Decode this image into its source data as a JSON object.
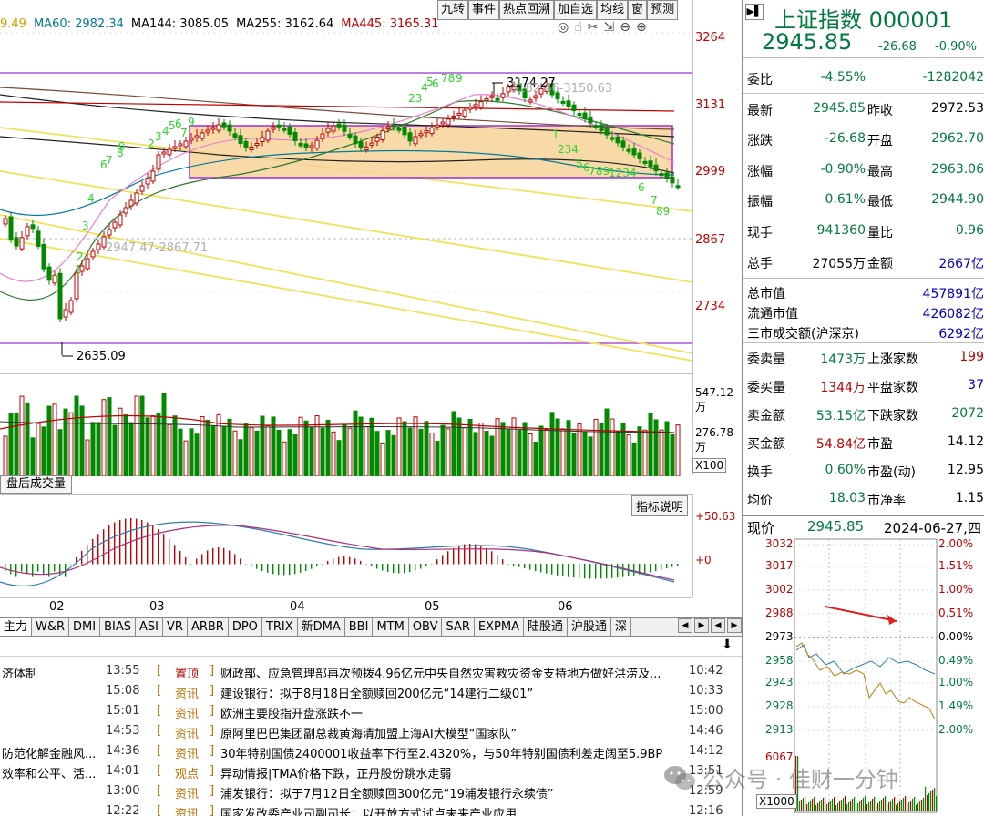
{
  "top_tabs": [
    "九转",
    "事件",
    "热点回溯",
    "加自选",
    "均线",
    "窗",
    "预测"
  ],
  "ma": [
    {
      "label": "9.49",
      "color": "#c9a400"
    },
    {
      "label": "MA60: 2982.34",
      "color": "#007a9a"
    },
    {
      "label": "MA144: 3085.05",
      "color": "#000000"
    },
    {
      "label": "MA255: 3162.64",
      "color": "#000000"
    },
    {
      "label": "MA445: 3165.31",
      "color": "#c00000"
    }
  ],
  "price_axis": [
    "3264",
    "3131",
    "2999",
    "2867",
    "2734"
  ],
  "annotations": {
    "high": "3174.27",
    "box_top": "3182.46-3150.63",
    "box_bottom": "2947.47-2867.71",
    "low": "2635.09"
  },
  "volume_axis": [
    "547.12万",
    "276.78万"
  ],
  "volume_multiplier": "X100",
  "volume_label": "盘后成交量",
  "macd_help": "指标说明",
  "macd_axis": [
    "+50.63",
    "+0"
  ],
  "x_axis": [
    "02",
    "03",
    "04",
    "05",
    "06"
  ],
  "indicator_tabs": [
    "主力",
    "W&R",
    "DMI",
    "BIAS",
    "ASI",
    "VR",
    "ARBR",
    "DPO",
    "TRIX",
    "新DMA",
    "BBI",
    "MTM",
    "OBV",
    "SAR",
    "EXPMA",
    "陆股通",
    "沪股通",
    "深"
  ],
  "news": [
    {
      "left": "济体制",
      "time": "13:55",
      "cat": "置顶",
      "title": "财政部、应急管理部再次预拨4.96亿元中央自然灾害救灾资金支持地方做好洪涝及...",
      "time2": "10:42"
    },
    {
      "left": "",
      "time": "15:08",
      "cat": "资讯",
      "title": "建设银行：拟于8月18日全额赎回200亿元“14建行二级01”",
      "time2": "10:33"
    },
    {
      "left": "",
      "time": "15:01",
      "cat": "资讯",
      "title": "欧洲主要股指开盘涨跌不一",
      "time2": "15:00"
    },
    {
      "left": "",
      "time": "14:53",
      "cat": "资讯",
      "title": "原阿里巴巴集团副总裁黄海清加盟上海AI大模型“国家队”",
      "time2": "14:46"
    },
    {
      "left": "防范化解金融风...",
      "time": "14:36",
      "cat": "资讯",
      "title": "30年特别国债2400001收益率下行至2.4320%，与50年特别国债利差走阔至5.9BP",
      "time2": "14:12"
    },
    {
      "left": "效率和公平、活...",
      "time": "14:01",
      "cat": "观点",
      "title": "异动情报|TMA价格下跌，正丹股份跳水走弱",
      "time2": "13:51"
    },
    {
      "left": "",
      "time": "13:00",
      "cat": "资讯",
      "title": "浦发银行：拟于7月12日全额赎回300亿元“19浦发银行永续债”",
      "time2": "12:59"
    },
    {
      "left": "",
      "time": "12:22",
      "cat": "资讯",
      "title": "国家发改委产业司副司长：以开放方式试点未来产业应用",
      "time2": "12:16"
    }
  ],
  "quote": {
    "name": "上证指数 000001",
    "price": "2945.85",
    "change": "-26.68",
    "pct": "-0.90%",
    "rows": [
      {
        "l1": "委比",
        "v1": "-4.55%",
        "l2": "",
        "v2": "-1282042",
        "c1": "green",
        "c2": "green"
      },
      {
        "l1": "最新",
        "v1": "2945.85",
        "l2": "昨收",
        "v2": "2972.53",
        "c1": "green",
        "c2": "black"
      },
      {
        "l1": "涨跌",
        "v1": "-26.68",
        "l2": "开盘",
        "v2": "2962.70",
        "c1": "green",
        "c2": "green"
      },
      {
        "l1": "涨幅",
        "v1": "-0.90%",
        "l2": "最高",
        "v2": "2963.06",
        "c1": "green",
        "c2": "green"
      },
      {
        "l1": "振幅",
        "v1": "0.61%",
        "l2": "最低",
        "v2": "2944.90",
        "c1": "green",
        "c2": "green"
      },
      {
        "l1": "现手",
        "v1": "941360",
        "l2": "量比",
        "v2": "0.96",
        "c1": "green",
        "c2": "green"
      },
      {
        "l1": "总手",
        "v1": "27055万",
        "l2": "金额",
        "v2": "2667亿",
        "c1": "black",
        "c2": "blue"
      }
    ],
    "market": [
      {
        "label": "总市值",
        "value": "457891亿"
      },
      {
        "label": "流通市值",
        "value": "426082亿"
      },
      {
        "label": "三市成交额(沪深京)",
        "value": "6292亿"
      }
    ],
    "rows2": [
      {
        "l1": "委卖量",
        "v1": "1473万",
        "l2": "上涨家数",
        "v2": "199",
        "c1": "green",
        "c2": "red"
      },
      {
        "l1": "委买量",
        "v1": "1344万",
        "l2": "平盘家数",
        "v2": "37",
        "c1": "red",
        "c2": "blue"
      },
      {
        "l1": "卖金额",
        "v1": "53.15亿",
        "l2": "下跌家数",
        "v2": "2072",
        "c1": "green",
        "c2": "green"
      },
      {
        "l1": "买金额",
        "v1": "54.84亿",
        "l2": "市盈",
        "v2": "14.12",
        "c1": "red",
        "c2": "black"
      },
      {
        "l1": "换手",
        "v1": "0.60%",
        "l2": "市盈(动)",
        "v2": "12.95",
        "c1": "green",
        "c2": "black"
      },
      {
        "l1": "均价",
        "v1": "18.03",
        "l2": "市净率",
        "v2": "1.15",
        "c1": "green",
        "c2": "black"
      }
    ],
    "tick_label": "现价",
    "tick_price": "2945.85",
    "tick_date": "2024-06-27,四"
  },
  "intraday": {
    "left_axis": [
      "3032",
      "3017",
      "3002",
      "2988",
      "2973",
      "2958",
      "2943",
      "2928",
      "2913"
    ],
    "right_axis": [
      "2.00%",
      "1.51%",
      "1.00%",
      "0.51%",
      "0.00%",
      "0.49%",
      "1.00%",
      "1.49%",
      "2.00%"
    ],
    "vol_axis": "6067",
    "x1000": "X1000"
  },
  "watermark": "公众号 · 佳财一分钟"
}
